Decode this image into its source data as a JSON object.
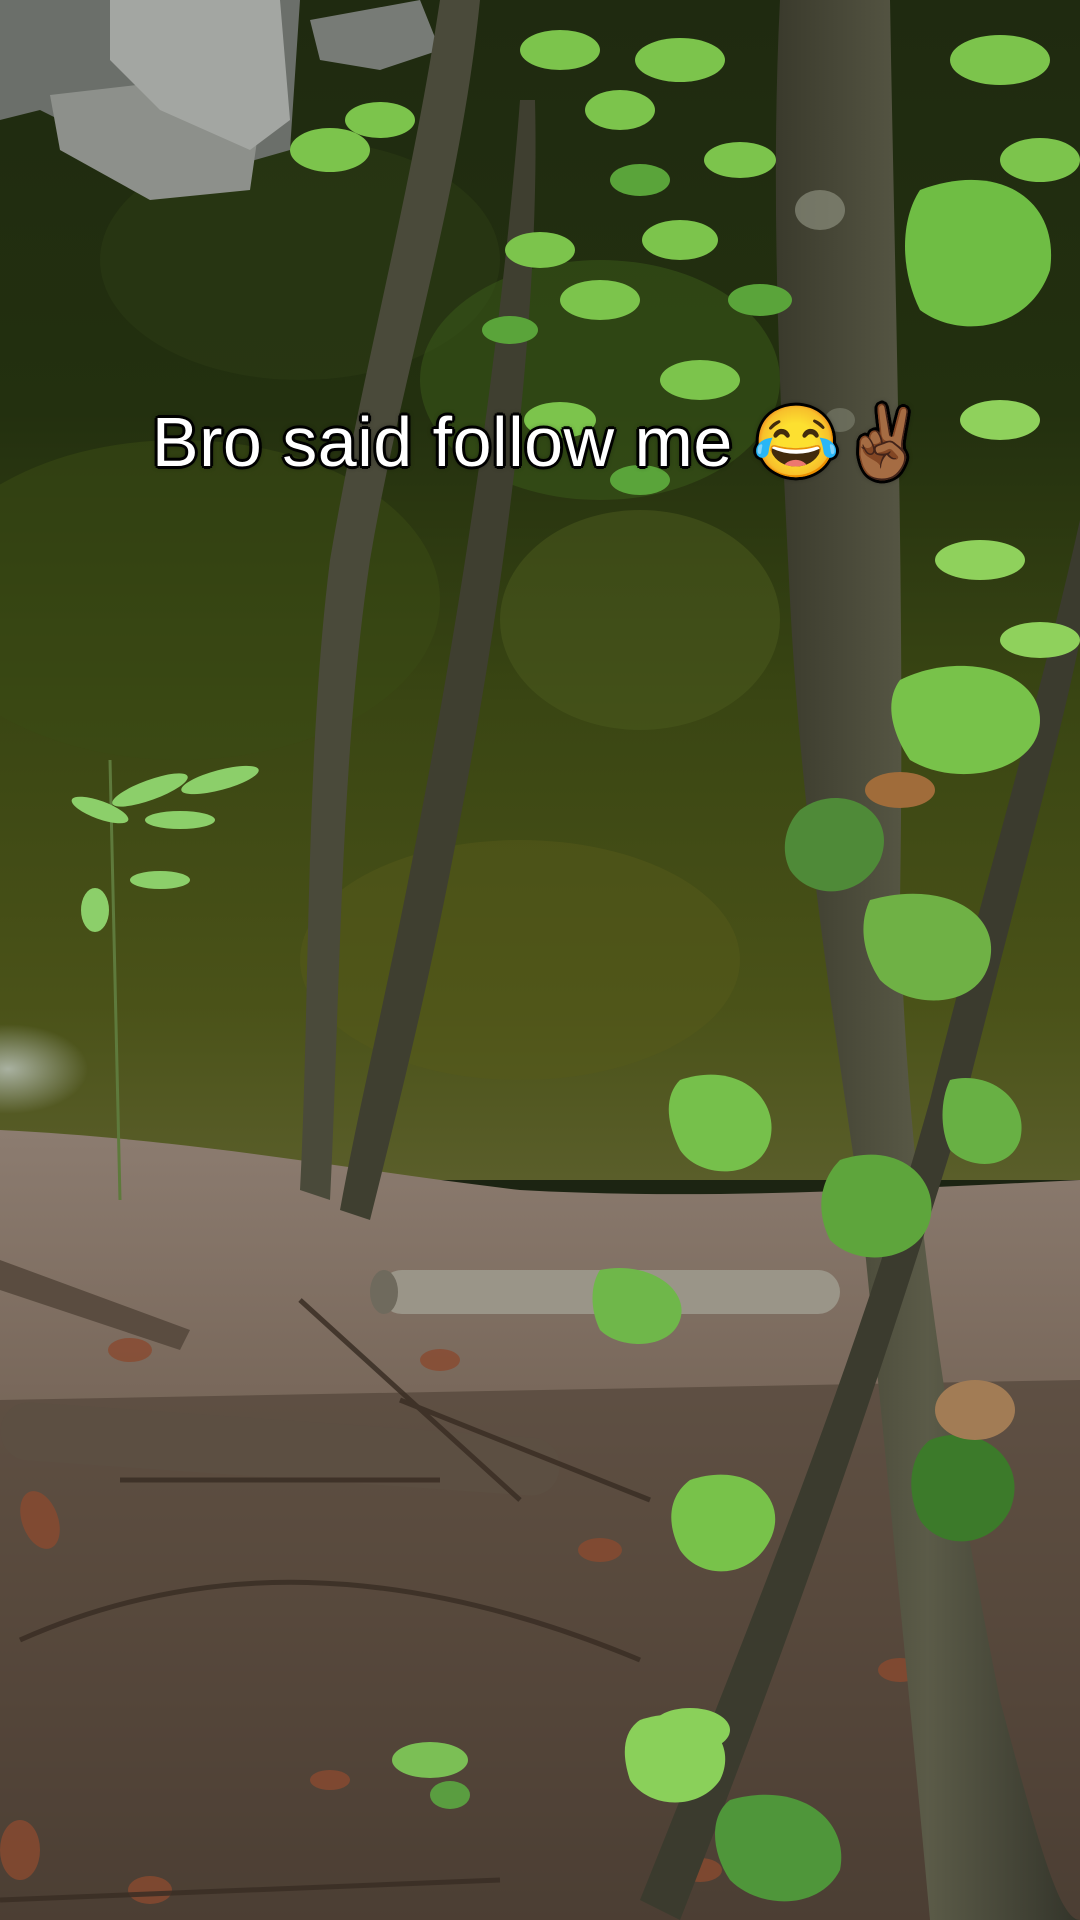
{
  "caption": {
    "text": "Bro said follow me 😂✌🏾"
  },
  "scene": {
    "description_colors": {
      "water_dark": "#23300f",
      "water_mid": "#3d4a14",
      "ground": "#7a6a5c",
      "bark": "#4b4a3a",
      "leaf_light": "#7dc44a",
      "leaf_dark": "#3f7d2a"
    }
  }
}
